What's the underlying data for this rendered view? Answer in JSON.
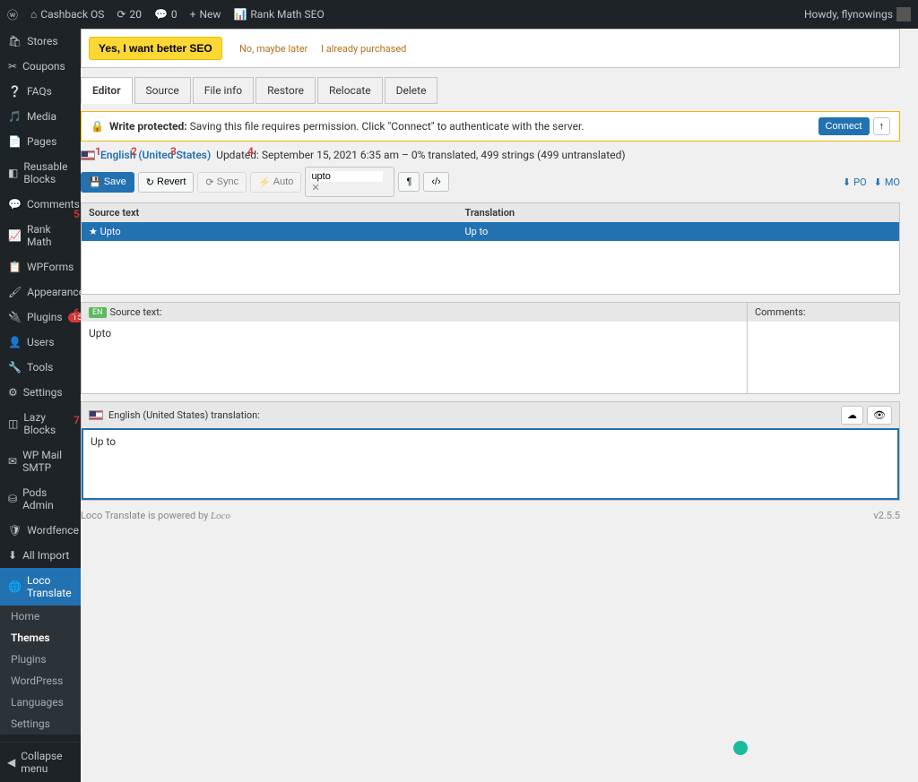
{
  "topbar": {
    "site_name": "Cashback OS",
    "updates_count": "20",
    "comments_count": "0",
    "new_label": "New",
    "rankmath_label": "Rank Math SEO",
    "howdy": "Howdy, flynowings"
  },
  "sidebar": {
    "items": [
      {
        "label": "Stores"
      },
      {
        "label": "Coupons"
      },
      {
        "label": "FAQs"
      },
      {
        "label": "Media"
      },
      {
        "label": "Pages"
      },
      {
        "label": "Reusable Blocks"
      },
      {
        "label": "Comments"
      },
      {
        "label": "Rank Math"
      },
      {
        "label": "WPForms"
      },
      {
        "label": "Appearance"
      },
      {
        "label": "Plugins",
        "badge": "15"
      },
      {
        "label": "Users"
      },
      {
        "label": "Tools"
      },
      {
        "label": "Settings"
      },
      {
        "label": "Lazy Blocks"
      },
      {
        "label": "WP Mail SMTP"
      },
      {
        "label": "Pods Admin"
      },
      {
        "label": "Wordfence"
      },
      {
        "label": "All Import"
      },
      {
        "label": "Loco Translate",
        "active": true
      }
    ],
    "submenu": [
      {
        "label": "Home"
      },
      {
        "label": "Themes",
        "bold": true
      },
      {
        "label": "Plugins"
      },
      {
        "label": "WordPress"
      },
      {
        "label": "Languages"
      },
      {
        "label": "Settings"
      }
    ],
    "collapse_label": "Collapse menu"
  },
  "promo": {
    "button": "Yes, I want better SEO",
    "link1": "No, maybe later",
    "link2": "I already purchased"
  },
  "tabs": [
    "Editor",
    "Source",
    "File info",
    "Restore",
    "Relocate",
    "Delete"
  ],
  "notice": {
    "title": "Write protected:",
    "text": "Saving this file requires permission. Click \"Connect\" to authenticate with the server.",
    "connect": "Connect"
  },
  "file_header": {
    "locale": "English (United States)",
    "meta": "Updated: September 15, 2021 6:35 am – 0% translated, 499 strings (499 untranslated)"
  },
  "toolbar": {
    "save": "Save",
    "revert": "Revert",
    "sync": "Sync",
    "auto": "Auto",
    "search_value": "upto",
    "po": "PO",
    "mo": "MO"
  },
  "grid": {
    "col_src": "Source text",
    "col_trans": "Translation",
    "row_src": "Upto",
    "row_trans": "Up to"
  },
  "panels": {
    "src_label": "Source text:",
    "src_value": "Upto",
    "src_tag": "EN",
    "comments_label": "Comments:",
    "trans_label": "English (United States) translation:",
    "trans_value": "Up to"
  },
  "footer": {
    "text": "Loco Translate is powered by",
    "logo": "Loco",
    "version": "v2.5.5"
  },
  "annotations": {
    "a1": "1",
    "a2": "2",
    "a3": "3",
    "a4": "4",
    "a5": "5",
    "a6": "6",
    "a7": "7"
  }
}
